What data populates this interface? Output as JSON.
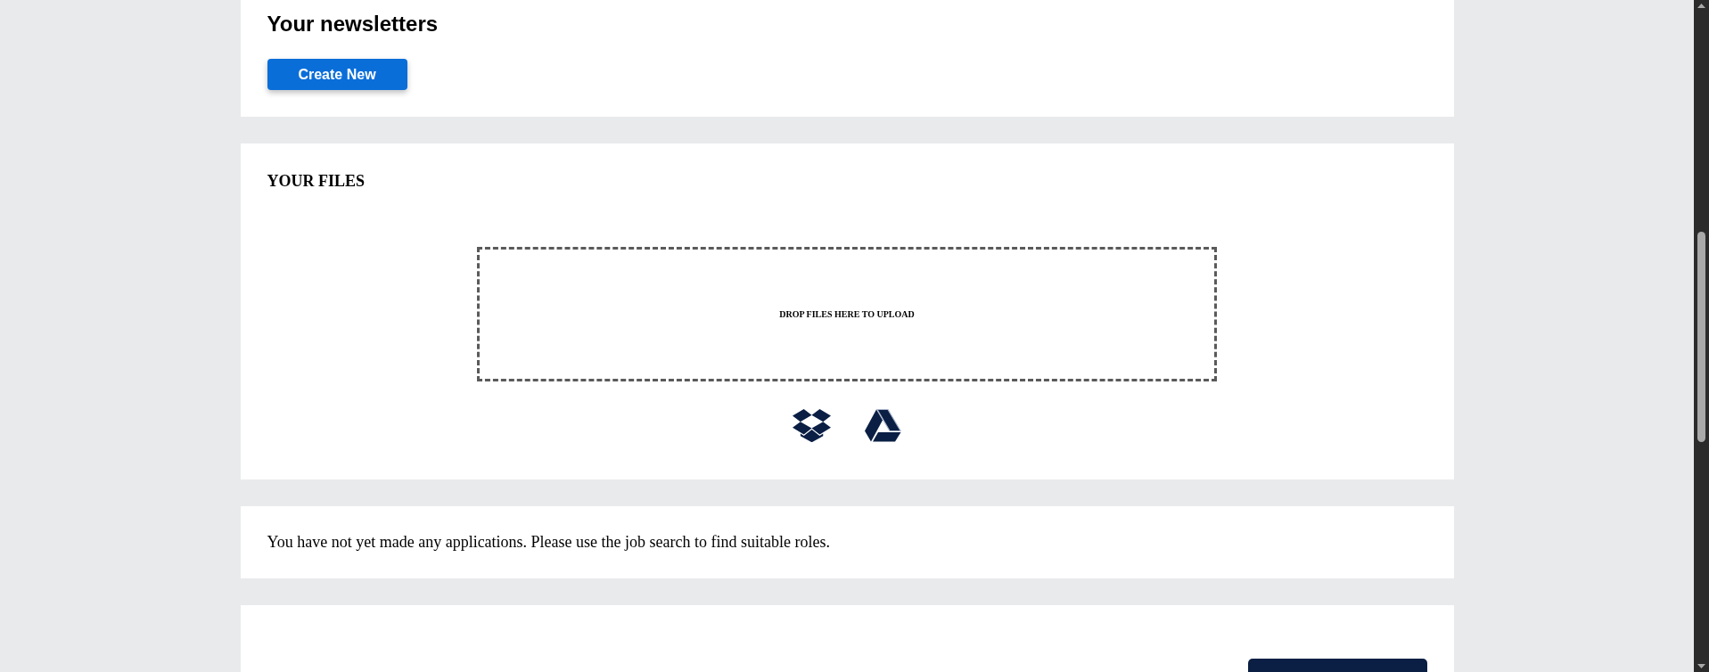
{
  "newsletters": {
    "title": "Your newsletters",
    "button": "Create New"
  },
  "files": {
    "title": "YOUR FILES",
    "drop_zone": "DROP FILES HERE TO UPLOAD",
    "sources": [
      {
        "kind": "boxes"
      },
      {
        "kind": "triangle"
      }
    ]
  },
  "applications": {
    "message": "You have not yet made any applications. Please use the job search to find suitable roles."
  },
  "footer": {
    "button": {
      "kind": "primary"
    }
  }
}
